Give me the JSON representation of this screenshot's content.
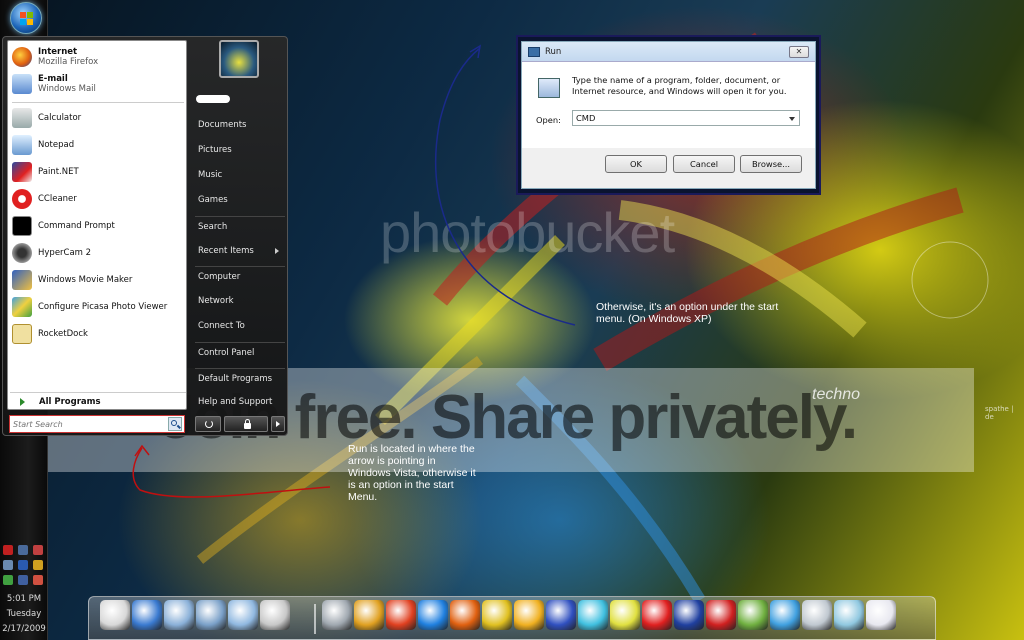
{
  "colors": {
    "orb": "#1c64b8",
    "start_menu_bg": "#1c1c1c",
    "dialog_bg": "#f0f0f0",
    "annotation_text": "#ffffff",
    "annotation_arrow": "#c01010",
    "annotation_arrow_blue": "#1a2a8a"
  },
  "start_menu": {
    "pinned": [
      {
        "title": "Internet",
        "subtitle": "Mozilla Firefox",
        "icon": "firefox-icon"
      },
      {
        "title": "E-mail",
        "subtitle": "Windows Mail",
        "icon": "mail-icon"
      }
    ],
    "recent": [
      {
        "label": "Calculator",
        "icon": "calculator-icon"
      },
      {
        "label": "Notepad",
        "icon": "notepad-icon"
      },
      {
        "label": "Paint.NET",
        "icon": "paint-icon"
      },
      {
        "label": "CCleaner",
        "icon": "ccleaner-icon"
      },
      {
        "label": "Command Prompt",
        "icon": "cmd-icon"
      },
      {
        "label": "HyperCam 2",
        "icon": "hypercam-icon"
      },
      {
        "label": "Windows Movie Maker",
        "icon": "moviemaker-icon"
      },
      {
        "label": "Configure Picasa Photo Viewer",
        "icon": "picasa-icon"
      },
      {
        "label": "RocketDock",
        "icon": "rocketdock-icon"
      }
    ],
    "all_programs": "All Programs",
    "search_placeholder": "Start Search",
    "right_items": [
      {
        "label": "Documents"
      },
      {
        "label": "Pictures"
      },
      {
        "label": "Music"
      },
      {
        "label": "Games"
      },
      {
        "label": "Search"
      },
      {
        "label": "Recent Items",
        "submenu": true
      },
      {
        "label": "Computer"
      },
      {
        "label": "Network"
      },
      {
        "label": "Connect To"
      },
      {
        "label": "Control Panel"
      },
      {
        "label": "Default Programs"
      },
      {
        "label": "Help and Support"
      }
    ]
  },
  "run_dialog": {
    "title": "Run",
    "close": "✕",
    "description": "Type the name of a program, folder, document, or Internet resource, and Windows will open it for you.",
    "open_label": "Open:",
    "open_value": "CMD",
    "ok": "OK",
    "cancel": "Cancel",
    "browse": "Browse..."
  },
  "annotations": {
    "xp_note": "Otherwise, it's an option under the start menu. (On Windows XP)",
    "vista_note": "Run is located in where the arrow is pointing in Windows Vista, otherwise it is an option in the start Menu."
  },
  "watermark": {
    "text": "Join free. Share privately.",
    "logo": "photobucket"
  },
  "wallpaper": {
    "brand": "techno",
    "signature": "spathe | de"
  },
  "clock": {
    "time": "5:01 PM",
    "day": "Tuesday",
    "date": "2/17/2009"
  },
  "dock": {
    "icons": [
      "computer-icon",
      "network-globe-icon",
      "folder-icon",
      "folder-open-icon",
      "folder-pictures-icon",
      "tools-icon",
      "recycle-bin-icon",
      "pick-hammer-icon",
      "ccleaner-icon",
      "internet-explorer-icon",
      "firefox-icon",
      "chrome-icon",
      "winamp-icon",
      "paint-icon",
      "star-burst-icon",
      "counter-icon",
      "aim-icon",
      "nti-icon",
      "acrobat-icon",
      "picture-viewer-icon",
      "messenger-icon",
      "calculator-icon",
      "notes-icon",
      "mail-icon"
    ]
  }
}
